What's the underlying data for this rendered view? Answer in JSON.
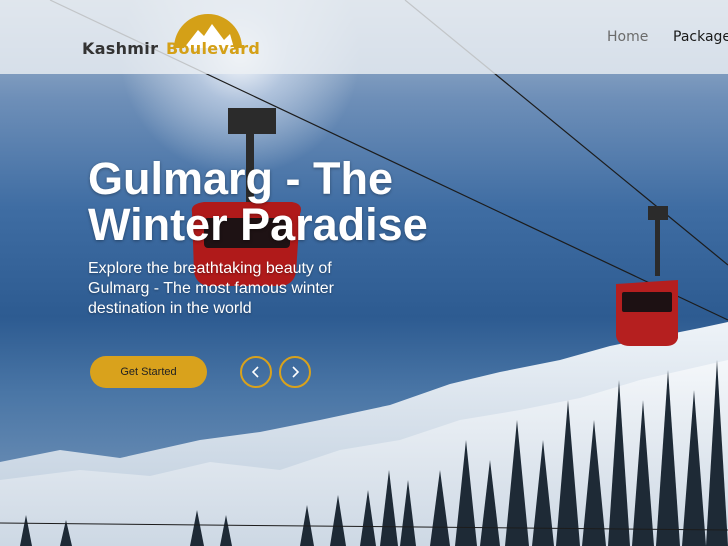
{
  "navbar": {
    "logo": {
      "word1": "Kashmir",
      "word2": "Boulevard",
      "brand_color": "#d4a017"
    },
    "links": [
      {
        "label": "Home"
      },
      {
        "label": "Package"
      }
    ]
  },
  "hero": {
    "title": "Gulmarg - The Winter Paradise",
    "subtitle": "Explore the breathtaking beauty of Gulmarg - The most famous winter destination in the world",
    "cta_label": "Get Started",
    "prev_icon": "chevron-left-icon",
    "next_icon": "chevron-right-icon"
  },
  "colors": {
    "accent": "#d9a21c",
    "nav_bg": "#eceff4",
    "text_light": "#ffffff"
  }
}
